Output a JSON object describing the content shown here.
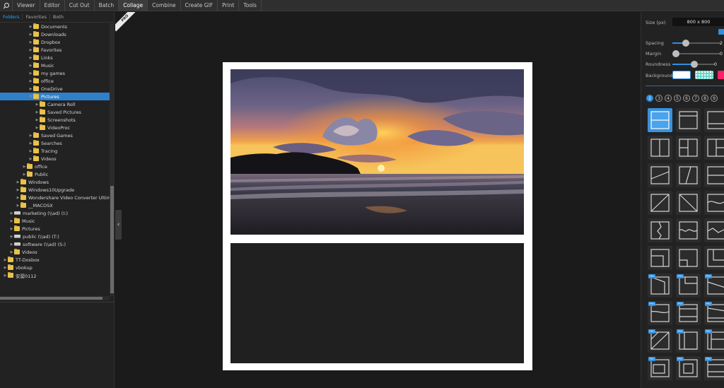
{
  "menu": {
    "items": [
      "Viewer",
      "Editor",
      "Cut Out",
      "Batch",
      "Collage",
      "Combine",
      "Create GIF",
      "Print",
      "Tools"
    ],
    "active": "Collage"
  },
  "left_tabs": [
    "Folders",
    "Favorites",
    "Both"
  ],
  "tree": [
    {
      "label": "Documents",
      "level": 4
    },
    {
      "label": "Downloads",
      "level": 4
    },
    {
      "label": "Dropbox",
      "level": 4
    },
    {
      "label": "Favorites",
      "level": 4
    },
    {
      "label": "Links",
      "level": 4
    },
    {
      "label": "Music",
      "level": 4
    },
    {
      "label": "my games",
      "level": 4
    },
    {
      "label": "office",
      "level": 4
    },
    {
      "label": "OneDrive",
      "level": 4
    },
    {
      "label": "Pictures",
      "level": 4,
      "selected": true,
      "expanded": true
    },
    {
      "label": "Camera Roll",
      "level": 5
    },
    {
      "label": "Saved Pictures",
      "level": 5
    },
    {
      "label": "Screenshots",
      "level": 5
    },
    {
      "label": "VideoProc",
      "level": 5
    },
    {
      "label": "Saved Games",
      "level": 4
    },
    {
      "label": "Searches",
      "level": 4
    },
    {
      "label": "Tracing",
      "level": 4
    },
    {
      "label": "Videos",
      "level": 4
    },
    {
      "label": "office",
      "level": 3
    },
    {
      "label": "Public",
      "level": 3
    },
    {
      "label": "Windows",
      "level": 2
    },
    {
      "label": "Windows10Upgrade",
      "level": 2
    },
    {
      "label": "Wondershare Video Converter Ultim",
      "level": 2
    },
    {
      "label": "__MACOSX",
      "level": 2
    },
    {
      "label": "marketing (\\\\ad) (I:)",
      "level": 1,
      "drive": true
    },
    {
      "label": "Music",
      "level": 1
    },
    {
      "label": "Pictures",
      "level": 1
    },
    {
      "label": "public (\\\\ad) (T:)",
      "level": 1,
      "drive": true
    },
    {
      "label": "software (\\\\ad) (S:)",
      "level": 1,
      "drive": true
    },
    {
      "label": "Videos",
      "level": 1
    },
    {
      "label": "TT-Dosbox",
      "level": 0
    },
    {
      "label": "vbokup",
      "level": 0
    },
    {
      "label": "安罂0112",
      "level": 0
    }
  ],
  "pro_badge": "PRO",
  "settings": {
    "size_label": "Size (px)",
    "size_value": "800 x 800",
    "spacing_label": "Spacing",
    "spacing_value": "2",
    "margin_label": "Margin",
    "margin_value": "0",
    "roundness_label": "Roundness",
    "roundness_value": "0",
    "background_label": "Background"
  },
  "colors": {
    "accent": "#2f8fe0",
    "selection": "#2f80c8",
    "background_swatch_pink": "#ff1f6a",
    "background_swatch_teal": "#6fd3c8"
  },
  "template_tabs": [
    "2",
    "3",
    "4",
    "5",
    "6",
    "7",
    "8",
    "9"
  ],
  "active_template_tab": "2",
  "template_pro_label": "PRO"
}
